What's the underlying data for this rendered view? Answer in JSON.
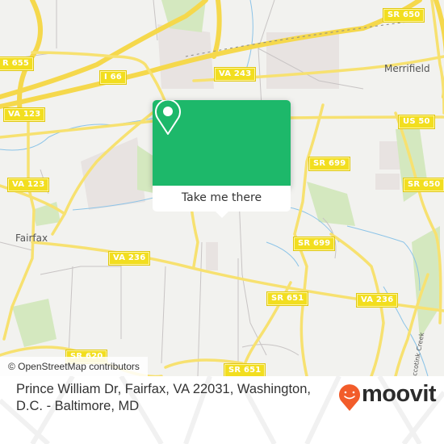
{
  "map": {
    "road_shields": [
      {
        "label": "SR 650"
      },
      {
        "label": "I 66"
      },
      {
        "label": "VA 243"
      },
      {
        "label": "R 655"
      },
      {
        "label": "VA 123"
      },
      {
        "label": "VA 123"
      },
      {
        "label": "US 50"
      },
      {
        "label": "SR 699"
      },
      {
        "label": "SR 650"
      },
      {
        "label": "SR 699"
      },
      {
        "label": "VA 236"
      },
      {
        "label": "SR 651"
      },
      {
        "label": "VA 236"
      },
      {
        "label": "SR 620"
      },
      {
        "label": "SR 651"
      }
    ],
    "places": {
      "merrifield": "Merrifield",
      "fairfax": "Fairfax",
      "accotink_creek": "Accotink Creek"
    },
    "attribution": "© OpenStreetMap contributors"
  },
  "popup": {
    "button_label": "Take me there",
    "accent_color": "#1db86a"
  },
  "footer": {
    "address": "Prince William Dr, Fairfax, VA 22031, Washington, D.C. - Baltimore, MD",
    "brand_name": "moovit",
    "brand_color": "#f25c2a"
  }
}
